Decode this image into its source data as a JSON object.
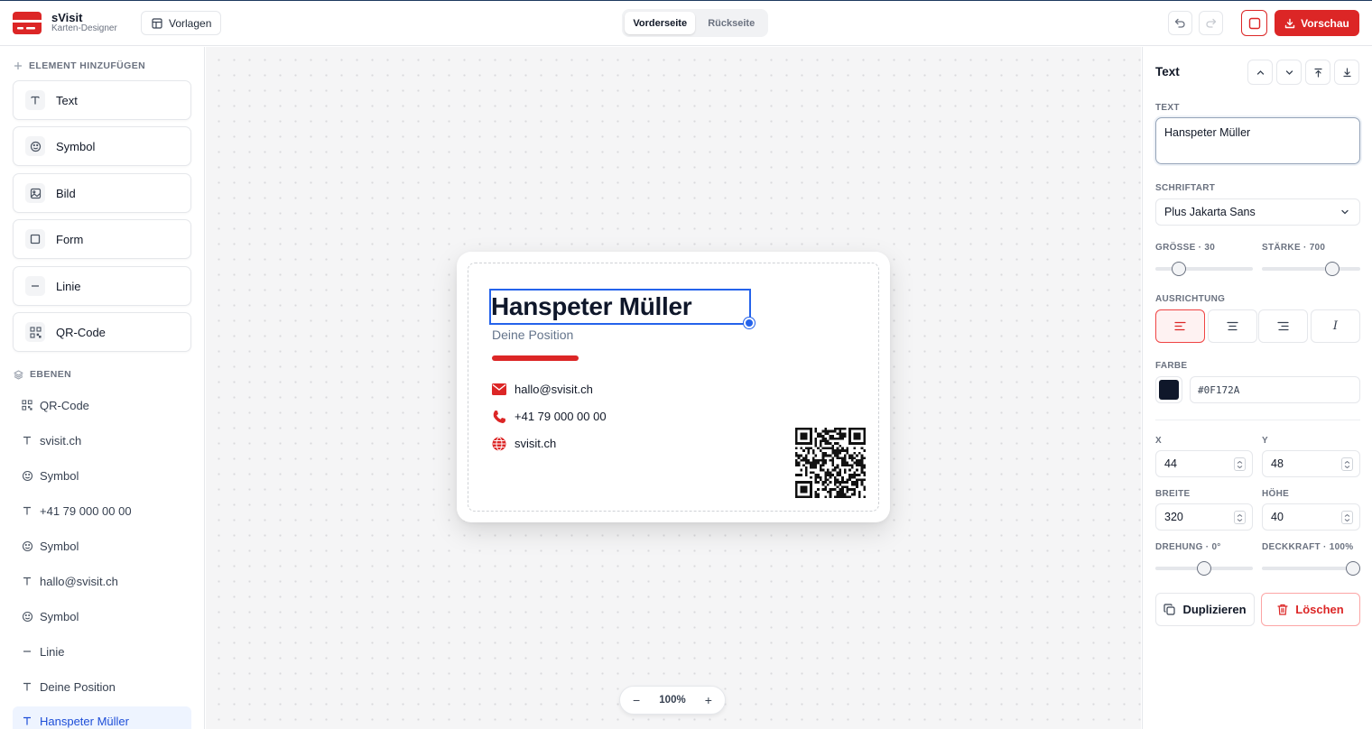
{
  "app": {
    "name": "sVisit",
    "subtitle": "Karten-Designer"
  },
  "header": {
    "templates_label": "Vorlagen",
    "tabs": [
      {
        "label": "Vorderseite",
        "active": true
      },
      {
        "label": "Rückseite",
        "active": false
      }
    ],
    "preview_label": "Vorschau"
  },
  "sidebar": {
    "add_heading": "ELEMENT HINZUFÜGEN",
    "add_items": [
      {
        "label": "Text",
        "icon": "text-icon"
      },
      {
        "label": "Symbol",
        "icon": "smiley-icon"
      },
      {
        "label": "Bild",
        "icon": "image-icon"
      },
      {
        "label": "Form",
        "icon": "square-icon"
      },
      {
        "label": "Linie",
        "icon": "line-icon"
      },
      {
        "label": "QR-Code",
        "icon": "qr-icon"
      }
    ],
    "layers_heading": "EBENEN",
    "layers": [
      {
        "label": "QR-Code",
        "icon": "qr-icon"
      },
      {
        "label": "svisit.ch",
        "icon": "text-icon"
      },
      {
        "label": "Symbol",
        "icon": "smiley-icon"
      },
      {
        "label": "+41 79 000 00 00",
        "icon": "text-icon"
      },
      {
        "label": "Symbol",
        "icon": "smiley-icon"
      },
      {
        "label": "hallo@svisit.ch",
        "icon": "text-icon"
      },
      {
        "label": "Symbol",
        "icon": "smiley-icon"
      },
      {
        "label": "Linie",
        "icon": "line-icon"
      },
      {
        "label": "Deine Position",
        "icon": "text-icon"
      },
      {
        "label": "Hanspeter Müller",
        "icon": "text-icon",
        "selected": true
      }
    ]
  },
  "card": {
    "name": "Hanspeter Müller",
    "position": "Deine Position",
    "email": "hallo@svisit.ch",
    "phone": "+41 79 000 00 00",
    "website": "svisit.ch",
    "accent_color": "#DC2626",
    "text_color": "#0F172A"
  },
  "zoom": {
    "minus": "−",
    "value": "100%",
    "plus": "+"
  },
  "panel": {
    "title": "Text",
    "text_label": "TEXT",
    "text_value": "Hanspeter Müller",
    "font_label": "SCHRIFTART",
    "font_value": "Plus Jakarta Sans",
    "size_label": "GRÖSSE · 30",
    "size_fraction": 0.2,
    "weight_label": "STÄRKE · 700",
    "weight_fraction": 0.75,
    "align_label": "AUSRICHTUNG",
    "align_options": [
      "left",
      "center",
      "right",
      "italic"
    ],
    "align_italic_glyph": "I",
    "color_label": "FARBE",
    "color_value": "#0F172A",
    "x_label": "X",
    "x_value": "44",
    "y_label": "Y",
    "y_value": "48",
    "width_label": "BREITE",
    "width_value": "320",
    "height_label": "HÖHE",
    "height_value": "40",
    "rotation_label": "DREHUNG · 0°",
    "rotation_fraction": 0.5,
    "opacity_label": "DECKKRAFT · 100%",
    "opacity_fraction": 1.0,
    "duplicate_label": "Duplizieren",
    "delete_label": "Löschen"
  }
}
